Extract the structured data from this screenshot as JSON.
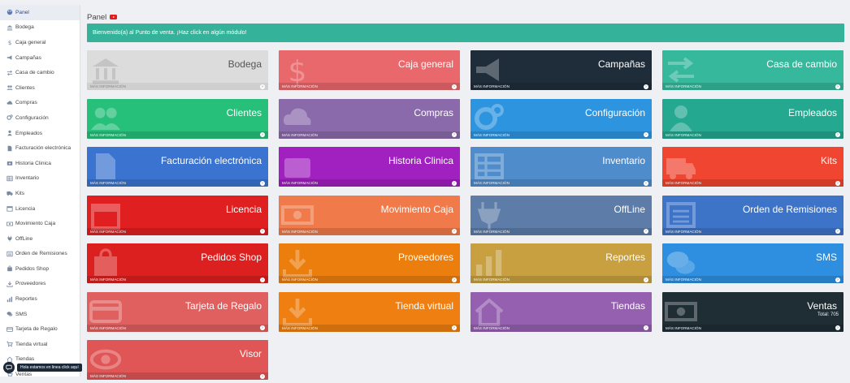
{
  "sidebar": {
    "items": [
      {
        "label": "Panel",
        "icon": "palette-icon",
        "active": true
      },
      {
        "label": "Bodega",
        "icon": "bank-icon"
      },
      {
        "label": "Caja general",
        "icon": "dollar-icon"
      },
      {
        "label": "Campañas",
        "icon": "bullhorn-icon"
      },
      {
        "label": "Casa de cambio",
        "icon": "exchange-icon"
      },
      {
        "label": "Clientes",
        "icon": "users-icon"
      },
      {
        "label": "Compras",
        "icon": "cloud-download-icon"
      },
      {
        "label": "Configuración",
        "icon": "cogs-icon"
      },
      {
        "label": "Empleados",
        "icon": "user-icon"
      },
      {
        "label": "Facturación electrónica",
        "icon": "file-icon"
      },
      {
        "label": "Historia Clinica",
        "icon": "medkit-icon"
      },
      {
        "label": "Inventario",
        "icon": "table-icon"
      },
      {
        "label": "Kits",
        "icon": "ambulance-icon"
      },
      {
        "label": "Licencia",
        "icon": "calendar-icon"
      },
      {
        "label": "Movimiento Caja",
        "icon": "money-icon"
      },
      {
        "label": "OffLine",
        "icon": "plug-icon"
      },
      {
        "label": "Orden de Remisiones",
        "icon": "list-icon"
      },
      {
        "label": "Pedidos Shop",
        "icon": "shopping-icon"
      },
      {
        "label": "Proveedores",
        "icon": "download-icon"
      },
      {
        "label": "Reportes",
        "icon": "bar-chart-icon"
      },
      {
        "label": "SMS",
        "icon": "comments-icon"
      },
      {
        "label": "Tarjeta de Regalo",
        "icon": "credit-card-icon"
      },
      {
        "label": "Tienda virtual",
        "icon": "shopping-cart-icon"
      },
      {
        "label": "Tiendas",
        "icon": "home-icon"
      },
      {
        "label": "Ventas",
        "icon": "shopping-cart-icon"
      }
    ]
  },
  "header": {
    "title": "Panel",
    "welcome": "Bienvenido(a) al Punto de venta. ¡Haz click en algún módulo!"
  },
  "tiles": [
    {
      "title": "Bodega",
      "footer": "Más información",
      "color": "#dcdcdc",
      "icon": "bank-icon",
      "light": true
    },
    {
      "title": "Caja general",
      "footer": "Más información",
      "color": "#e8686b",
      "icon": "dollar-icon"
    },
    {
      "title": "Campañas",
      "footer": "Más información",
      "color": "#1f2d3b",
      "icon": "bullhorn-icon"
    },
    {
      "title": "Casa de cambio",
      "footer": "Más información",
      "color": "#35b89c",
      "icon": "exchange-icon"
    },
    {
      "title": "Clientes",
      "footer": "Más información",
      "color": "#26c07a",
      "icon": "users-icon"
    },
    {
      "title": "Compras",
      "footer": "Más información",
      "color": "#8a6aab",
      "icon": "cloud-download-icon"
    },
    {
      "title": "Configuración",
      "footer": "Más información",
      "color": "#2d95e0",
      "icon": "cogs-icon"
    },
    {
      "title": "Empleados",
      "footer": "Más información",
      "color": "#24a890",
      "icon": "user-icon"
    },
    {
      "title": "Facturación electrónica",
      "footer": "Más información",
      "color": "#3b74d0",
      "icon": "file-icon"
    },
    {
      "title": "Historia Clinica",
      "footer": "Más información",
      "color": "#a020c0",
      "icon": "medkit-icon"
    },
    {
      "title": "Inventario",
      "footer": "Más información",
      "color": "#4f8ccc",
      "icon": "table-icon"
    },
    {
      "title": "Kits",
      "footer": "Más información",
      "color": "#f04530",
      "icon": "ambulance-icon"
    },
    {
      "title": "Licencia",
      "footer": "Más información",
      "color": "#e02020",
      "icon": "calendar-icon"
    },
    {
      "title": "Movimiento Caja",
      "footer": "Más información",
      "color": "#f07a4a",
      "icon": "money-icon"
    },
    {
      "title": "OffLine",
      "footer": "Más información",
      "color": "#5d7da8",
      "icon": "plug-icon"
    },
    {
      "title": "Orden de Remisiones",
      "footer": "Más información",
      "color": "#3e74c8",
      "icon": "list-icon"
    },
    {
      "title": "Pedidos Shop",
      "footer": "Más información",
      "color": "#dc2020",
      "icon": "shopping-icon"
    },
    {
      "title": "Proveedores",
      "footer": "Más información",
      "color": "#ec7e0e",
      "icon": "download-icon"
    },
    {
      "title": "Reportes",
      "footer": "Más información",
      "color": "#c8a040",
      "icon": "bar-chart-icon"
    },
    {
      "title": "SMS",
      "footer": "Más información",
      "color": "#2e8fe0",
      "icon": "comments-icon"
    },
    {
      "title": "Tarjeta de Regalo",
      "footer": "Más información",
      "color": "#e06060",
      "icon": "credit-card-icon"
    },
    {
      "title": "Tienda virtual",
      "footer": "Más información",
      "color": "#ee7f10",
      "icon": "download-icon"
    },
    {
      "title": "Tiendas",
      "footer": "Más información",
      "color": "#9560b0",
      "icon": "home-icon"
    },
    {
      "title": "Ventas",
      "subtitle": "Total: 705",
      "footer": "Más información",
      "color": "#1f2d35",
      "icon": "money-icon"
    },
    {
      "title": "Visor",
      "footer": "Más información",
      "color": "#e05555",
      "icon": "eye-icon"
    }
  ],
  "chat": {
    "label": "Hola estamos en linea click aquí",
    "icon": "chat-icon"
  }
}
